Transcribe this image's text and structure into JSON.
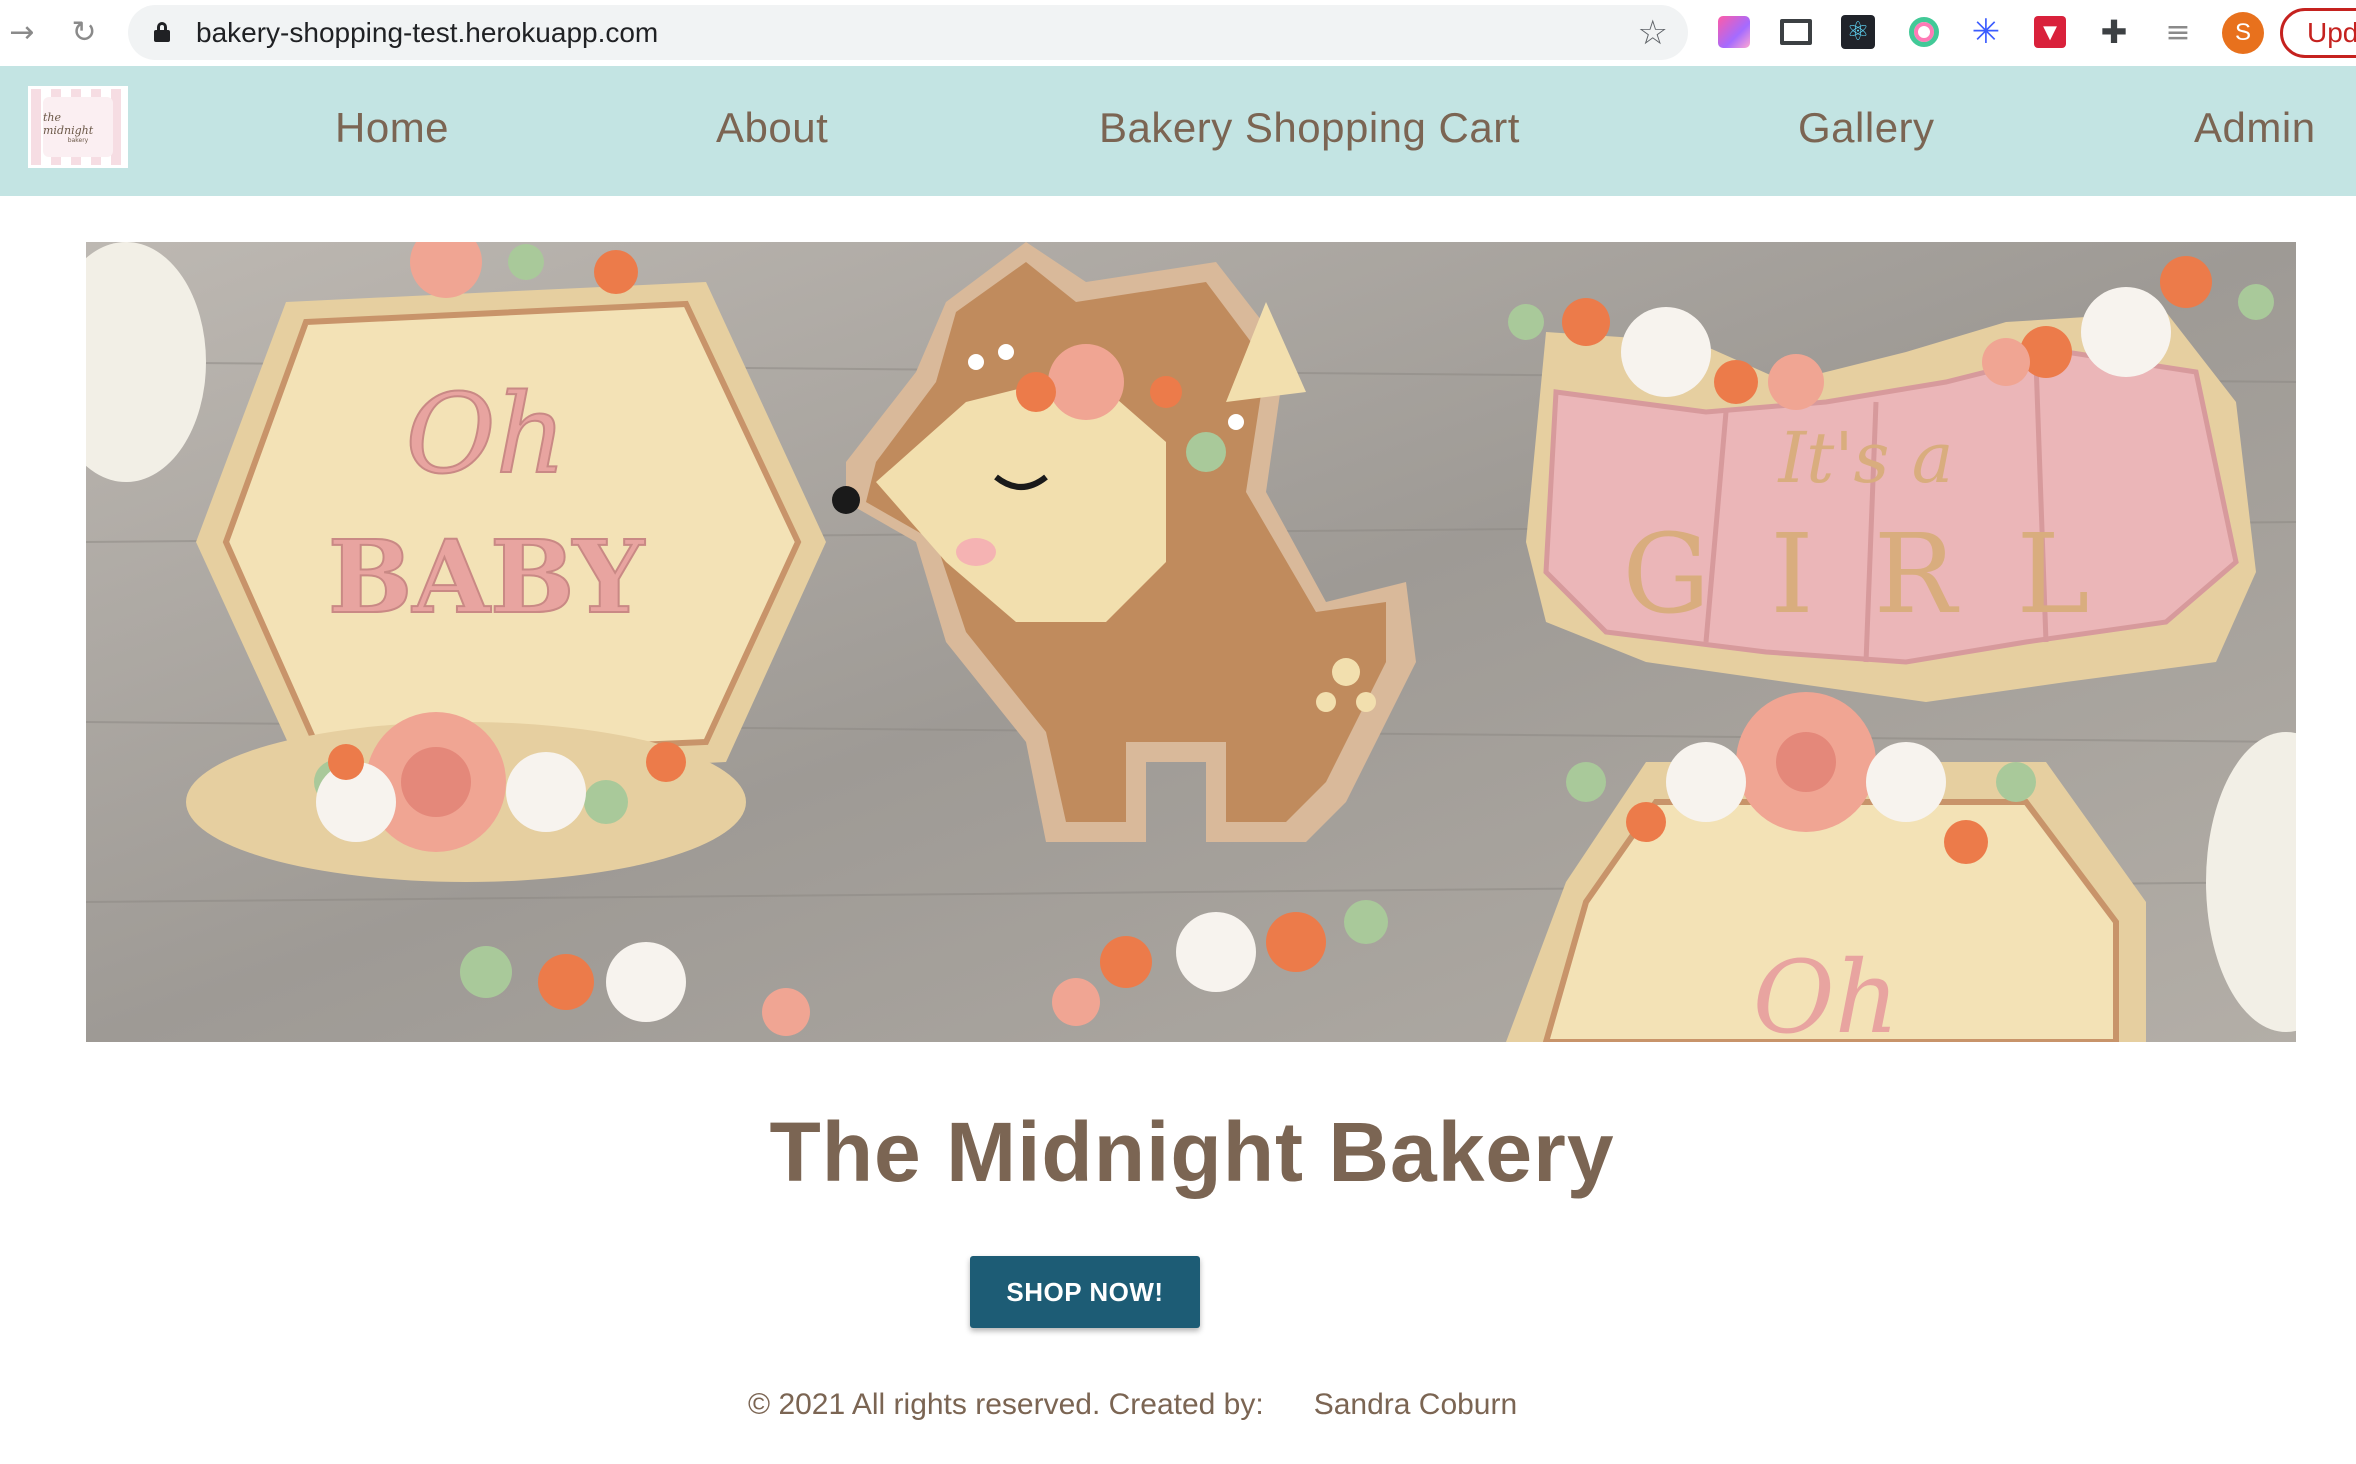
{
  "browser": {
    "url": "bakery-shopping-test.herokuapp.com",
    "back_icon": "→",
    "reload_icon": "↻",
    "star_icon": "☆",
    "profile_initial": "S",
    "update_label": "Upd",
    "extensions": [
      "gradient-extension-icon",
      "screen-capture-icon",
      "react-devtools-icon",
      "circle-extension-icon",
      "flower-extension-icon",
      "shield-extension-icon",
      "puzzle-icon",
      "media-control-icon"
    ]
  },
  "site": {
    "logo_text": "the midnight",
    "logo_subtext": "bakery",
    "nav": {
      "home": "Home",
      "about": "About",
      "cart": "Bakery Shopping Cart",
      "gallery": "Gallery",
      "admin": "Admin"
    },
    "hero": {
      "cookie_text_1": "Oh",
      "cookie_text_2": "BABY",
      "cookie_text_3": "It's a",
      "cookie_text_4": "GIRL"
    },
    "title": "The Midnight Bakery",
    "shop_button": "SHOP NOW!",
    "footer": {
      "text": "© 2021 All rights reserved. Created by:",
      "author": "Sandra Coburn"
    }
  },
  "colors": {
    "nav_bg": "#c3e4e3",
    "nav_text": "#7b6553",
    "button_bg": "#1d5c75",
    "title_text": "#7b6553"
  }
}
